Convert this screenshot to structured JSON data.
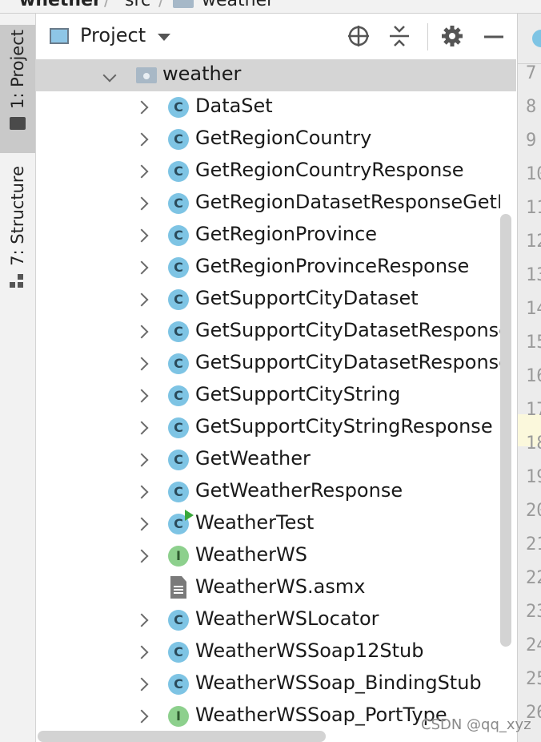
{
  "breadcrumb": {
    "project": "whether",
    "src": "src",
    "package": "weather"
  },
  "side_tabs": {
    "project": "1: Project",
    "structure": "7: Structure"
  },
  "toolbar": {
    "title": "Project",
    "icons": [
      "locate-icon",
      "collapse-all-icon",
      "gear-icon",
      "minimize-icon"
    ]
  },
  "tree": {
    "package_label": "weather",
    "items": [
      {
        "label": "DataSet",
        "kind": "class"
      },
      {
        "label": "GetRegionCountry",
        "kind": "class"
      },
      {
        "label": "GetRegionCountryResponse",
        "kind": "class"
      },
      {
        "label": "GetRegionDatasetResponseGetReg",
        "kind": "class"
      },
      {
        "label": "GetRegionProvince",
        "kind": "class"
      },
      {
        "label": "GetRegionProvinceResponse",
        "kind": "class"
      },
      {
        "label": "GetSupportCityDataset",
        "kind": "class"
      },
      {
        "label": "GetSupportCityDatasetResponse",
        "kind": "class"
      },
      {
        "label": "GetSupportCityDatasetResponseGe",
        "kind": "class"
      },
      {
        "label": "GetSupportCityString",
        "kind": "class"
      },
      {
        "label": "GetSupportCityStringResponse",
        "kind": "class"
      },
      {
        "label": "GetWeather",
        "kind": "class"
      },
      {
        "label": "GetWeatherResponse",
        "kind": "class"
      },
      {
        "label": "WeatherTest",
        "kind": "runnable-class"
      },
      {
        "label": "WeatherWS",
        "kind": "interface"
      },
      {
        "label": "WeatherWS.asmx",
        "kind": "file"
      },
      {
        "label": "WeatherWSLocator",
        "kind": "class"
      },
      {
        "label": "WeatherWSSoap12Stub",
        "kind": "class"
      },
      {
        "label": "WeatherWSSoap_BindingStub",
        "kind": "class"
      },
      {
        "label": "WeatherWSSoap_PortType",
        "kind": "interface"
      }
    ]
  },
  "class_glyph": "C",
  "interface_glyph": "I",
  "gutter": {
    "line_numbers": [
      "7",
      "8",
      "9",
      "10",
      "11",
      "12",
      "13",
      "14",
      "15",
      "16",
      "17",
      "18",
      "19",
      "20",
      "21",
      "22",
      "23",
      "24",
      "25",
      "26"
    ]
  },
  "watermark": "CSDN @qq_xyz",
  "colors": {
    "class_icon": "#7ec4e4",
    "interface_icon": "#8dd08d",
    "selection": "#d5d5d5"
  }
}
